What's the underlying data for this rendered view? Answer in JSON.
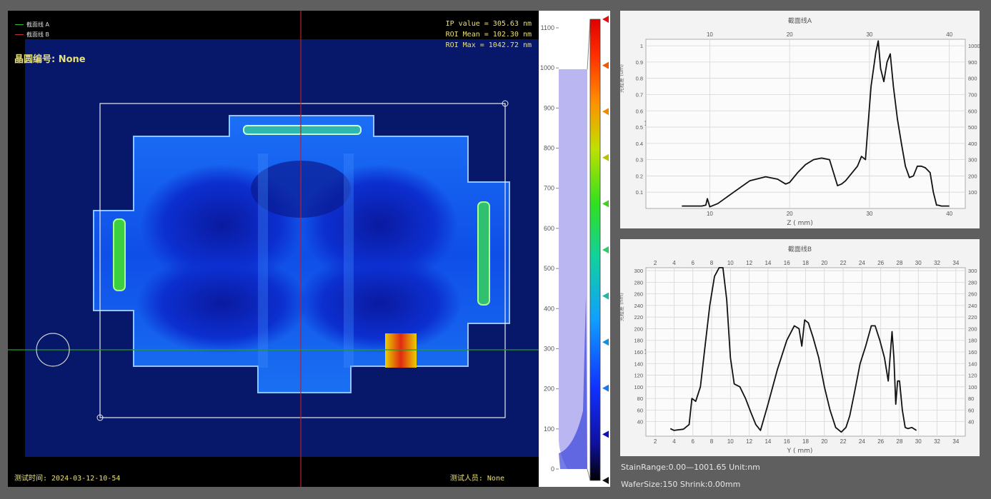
{
  "viewer": {
    "legend": [
      {
        "label": "截面线 A",
        "color": "#2fbf2f"
      },
      {
        "label": "截面线 B",
        "color": "#c03030"
      }
    ],
    "wafer_id_label": "晶圆编号: None",
    "stats": [
      "IP value = 305.63 nm",
      "ROI Mean = 102.30 nm",
      "ROI Max = 1042.72 nm"
    ],
    "test_time": "测试时间: 2024-03-12-10-54",
    "tester": "测试人员: None"
  },
  "colorbar": {
    "ticks": [
      "1100",
      "1000",
      "900",
      "800",
      "700",
      "600",
      "500",
      "400",
      "300",
      "200",
      "100",
      "0"
    ],
    "tick_values": [
      1100,
      1000,
      900,
      800,
      700,
      600,
      500,
      400,
      300,
      200,
      100,
      0
    ],
    "marker_colors": [
      "#e01010",
      "#f05a00",
      "#f08a00",
      "#b8c000",
      "#40d020",
      "#30c870",
      "#20b8a0",
      "#1090e0",
      "#1878f0",
      "#1010c0",
      "#101010"
    ]
  },
  "chart_data": [
    {
      "type": "line",
      "title": "截面线A",
      "xlabel": "Z ( mm)",
      "ylabel": "光程差 (um)",
      "annotation": "nan",
      "xlim": [
        2,
        42
      ],
      "ylim": [
        0,
        1.04
      ],
      "xticks_bottom": [
        10,
        20,
        30,
        40
      ],
      "xticks_top": [
        10,
        20,
        30,
        40
      ],
      "yticks_left": [
        0.1,
        0.2,
        0.3,
        0.4,
        0.5,
        0.6,
        0.7,
        0.8,
        0.9,
        1
      ],
      "yticks_right": [
        100,
        200,
        300,
        400,
        500,
        600,
        700,
        800,
        900,
        1000
      ],
      "series": [
        {
          "x": [
            6.5,
            8,
            9,
            9.5,
            9.7,
            10,
            11,
            13,
            15,
            17,
            18.5,
            19.5,
            20,
            21,
            22,
            23,
            24,
            25,
            25.5,
            26,
            26.5,
            27,
            27.5,
            28,
            28.5,
            29,
            29.5,
            29.8,
            30.2,
            30.8,
            31.1,
            31.4,
            31.8,
            32.2,
            32.6,
            33,
            33.5,
            34,
            34.5,
            35,
            35.5,
            36,
            36.5,
            37,
            37.6,
            38,
            38.4,
            38.6,
            39,
            40
          ],
          "y": [
            0.015,
            0.015,
            0.015,
            0.02,
            0.06,
            0.01,
            0.03,
            0.1,
            0.17,
            0.195,
            0.18,
            0.15,
            0.16,
            0.22,
            0.27,
            0.3,
            0.31,
            0.3,
            0.22,
            0.14,
            0.15,
            0.17,
            0.2,
            0.23,
            0.26,
            0.32,
            0.3,
            0.5,
            0.75,
            0.96,
            1.03,
            0.86,
            0.78,
            0.9,
            0.95,
            0.75,
            0.55,
            0.4,
            0.26,
            0.19,
            0.2,
            0.26,
            0.26,
            0.25,
            0.22,
            0.1,
            0.02,
            0.02,
            0.015,
            0.015
          ]
        }
      ]
    },
    {
      "type": "line",
      "title": "截面线B",
      "xlabel": "Y ( mm)",
      "ylabel": "光程差 (nm)",
      "annotation": "nan",
      "xlim": [
        1,
        35
      ],
      "ylim": [
        15,
        305
      ],
      "xticks_bottom": [
        2,
        4,
        6,
        8,
        10,
        12,
        14,
        16,
        18,
        20,
        22,
        24,
        26,
        28,
        30,
        32,
        34
      ],
      "xticks_top": [
        2,
        4,
        6,
        8,
        10,
        12,
        14,
        16,
        18,
        20,
        22,
        24,
        26,
        28,
        30,
        32,
        34
      ],
      "yticks_left": [
        40,
        60,
        80,
        100,
        120,
        140,
        160,
        180,
        200,
        220,
        240,
        260,
        280,
        300
      ],
      "yticks_right": [
        40,
        60,
        80,
        100,
        120,
        140,
        160,
        180,
        200,
        220,
        240,
        260,
        280,
        300
      ],
      "series": [
        {
          "x": [
            3.6,
            4,
            5,
            5.6,
            5.9,
            6.3,
            6.8,
            7.3,
            7.8,
            8.3,
            8.8,
            9.2,
            9.6,
            10,
            10.4,
            11,
            11.6,
            12.2,
            12.7,
            13.2,
            14,
            15,
            16,
            16.8,
            17.3,
            17.6,
            17.9,
            18.3,
            18.8,
            19.4,
            20,
            20.6,
            21.2,
            21.8,
            22.3,
            22.7,
            23.2,
            23.8,
            24.4,
            25,
            25.4,
            25.9,
            26.4,
            26.8,
            27.2,
            27.4,
            27.6,
            27.8,
            28,
            28.3,
            28.6,
            28.9,
            29.3,
            29.8
          ],
          "y": [
            28,
            25,
            27,
            35,
            80,
            75,
            100,
            170,
            240,
            290,
            305,
            305,
            250,
            150,
            105,
            100,
            80,
            55,
            35,
            25,
            70,
            130,
            180,
            205,
            200,
            170,
            215,
            210,
            185,
            150,
            100,
            60,
            30,
            22,
            30,
            50,
            90,
            140,
            170,
            205,
            205,
            180,
            150,
            110,
            195,
            150,
            70,
            110,
            110,
            60,
            30,
            28,
            30,
            25
          ]
        }
      ]
    }
  ],
  "status": {
    "line1": "StainRange:0.00—1001.65 Unit:nm",
    "line2": "WaferSize:150  Shrink:0.00mm"
  }
}
